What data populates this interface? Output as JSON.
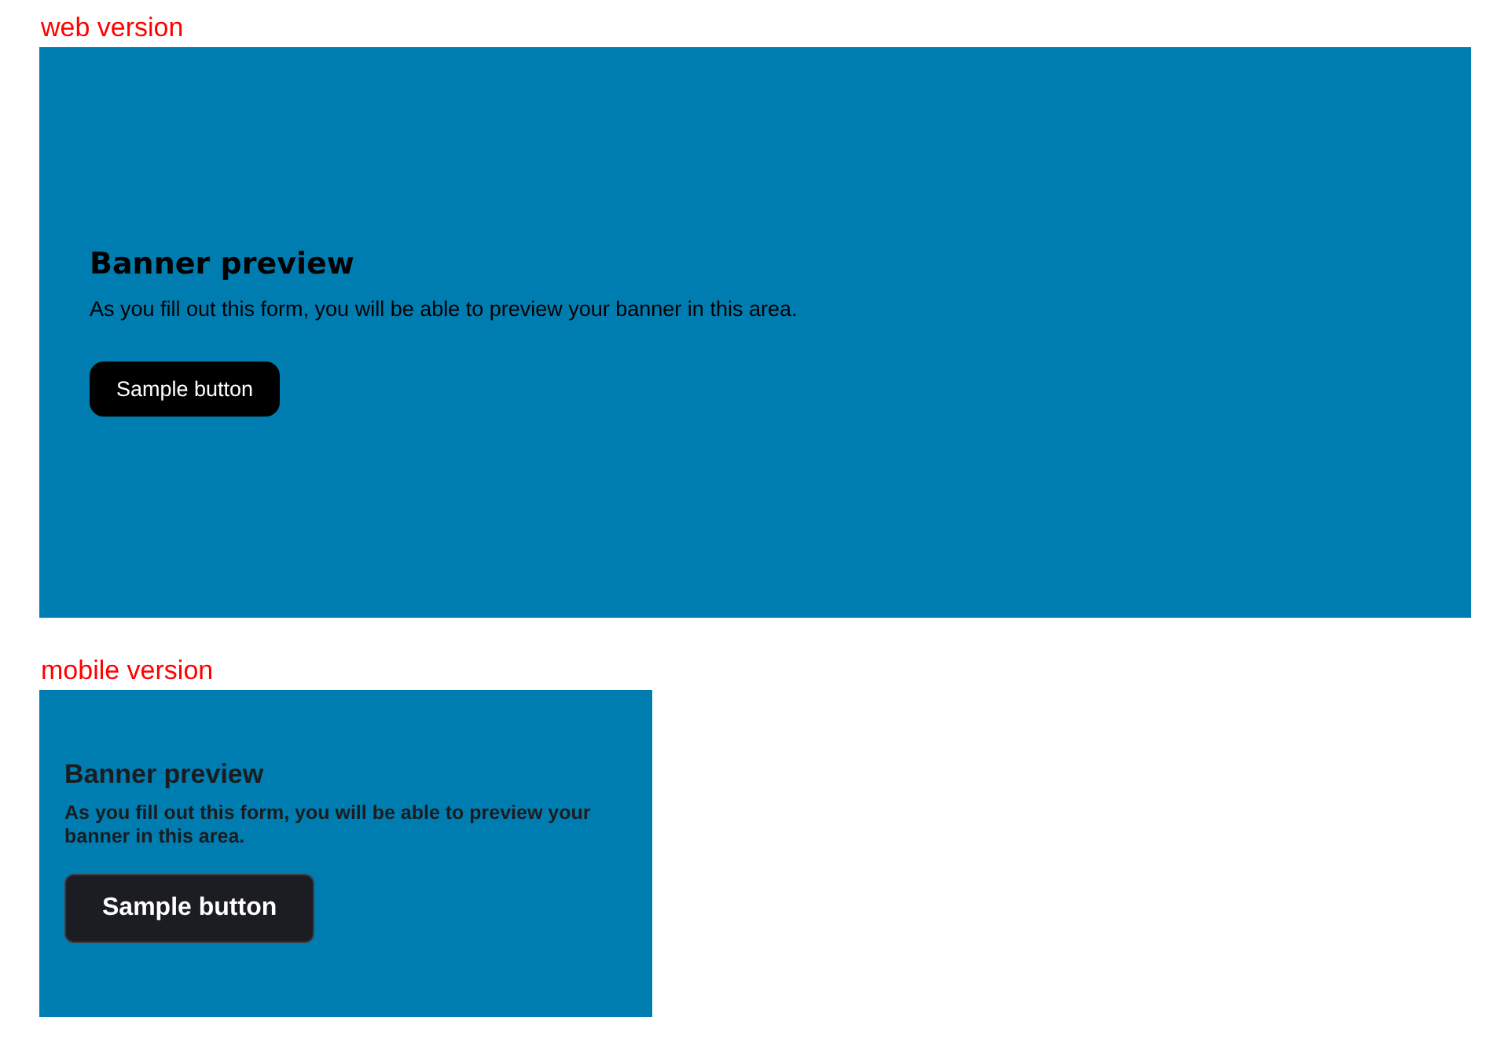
{
  "previews": [
    {
      "kind": "web",
      "label": "web version",
      "banner": {
        "title": "Banner preview",
        "text": "As you fill out this form, you will be able to preview your banner in this area.",
        "button": "Sample button"
      }
    },
    {
      "kind": "mobile",
      "label": "mobile version",
      "banner": {
        "title": "Banner preview",
        "text": "As you fill out this form, you will be able to preview your banner in this area.",
        "button": "Sample button"
      }
    }
  ]
}
